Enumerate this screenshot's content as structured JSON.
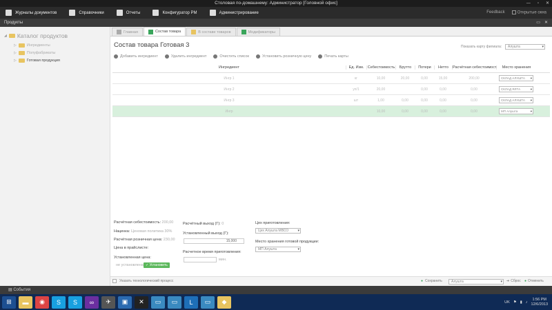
{
  "window": {
    "title": "Столовая по-домашнему: Администратор [Головной офис]",
    "controls": [
      "—",
      "▫",
      "✕"
    ]
  },
  "menu": {
    "items": [
      {
        "label": "Журналы документов",
        "icon": "journal-icon"
      },
      {
        "label": "Справочники",
        "icon": "book-icon"
      },
      {
        "label": "Отчеты",
        "icon": "report-icon"
      },
      {
        "label": "Конфигуратор PM",
        "icon": "config-icon"
      },
      {
        "label": "Администрирование",
        "icon": "admin-icon"
      }
    ],
    "feedback": "Feedback",
    "open_window": "Открытые окна"
  },
  "panel": {
    "title": "Продукты"
  },
  "tree": {
    "root": "Каталог продуктов",
    "items": [
      {
        "label": "Ингредиенты"
      },
      {
        "label": "Полуфабрикаты"
      },
      {
        "label": "Готовая продукция"
      }
    ]
  },
  "tabs": [
    {
      "label": "Главная"
    },
    {
      "label": "Состав товара"
    },
    {
      "label": "В составе товаров"
    },
    {
      "label": "Модификаторы"
    }
  ],
  "page": {
    "title": "Состав товара Готовая 3",
    "show_card_label": "Показать карту филиала:",
    "branch_select": "Алушта"
  },
  "toolbar": {
    "add": "Добавить ингредиент",
    "remove": "Удалить ингредиент",
    "clear": "Очистить список",
    "set_price": "Установить розничную цену",
    "print": "Печать карты"
  },
  "table": {
    "headers": [
      "Ингредиент",
      "Ед. Изм.",
      "Себестоимость",
      "Брутто",
      "Потери",
      "Нетто",
      "Расчётная себестоимость",
      "Место хранения"
    ],
    "rows": [
      [
        "Ингр 1",
        "кг",
        "10,00",
        "20,00",
        "0,00",
        "15,00",
        "200,00",
        "СКЛАД АЛУШТА"
      ],
      [
        "Ингр 2",
        "уп/1",
        "20,00",
        "",
        "0,00",
        "0,00",
        "0,00",
        "СКЛАД ЯЛТА"
      ],
      [
        "Ингр 3",
        "шт",
        "1,00",
        "0,00",
        "0,00",
        "0,00",
        "0,00",
        "СКЛАД АЛУШТА"
      ],
      [
        "Ингр",
        "",
        "10,00",
        "0,00",
        "0,00",
        "0,00",
        "0,00",
        "МП Алушта"
      ]
    ]
  },
  "bottom": {
    "calc_cost_label": "Расчётная себестоимость:",
    "calc_cost_value": "200,00",
    "markup_label": "Наценка:",
    "markup_value": "Ценовая политика 30%",
    "calc_retail_label": "Расчётная розничная цена:",
    "calc_retail_value": "230,00",
    "pricelist_label": "Цена в прайслисте:",
    "set_price_label": "Установленная цена:",
    "not_set": "не установлена",
    "set_button": "Установить",
    "calc_output_label": "Расчётный выход (Г):",
    "calc_output_value": "0",
    "set_output_label": "Установленный выход (Г):",
    "set_output_value": "15,000",
    "prep_time_label": "Расчетное время приготовления:",
    "prep_time_unit": "мин.",
    "workshop_label": "Цех приготовления:",
    "workshop_value": "Цех Алушта МВСО",
    "storage_label": "Место хранения готовой продукции:",
    "storage_value": "МП Алушта",
    "tech_process": "Указать технологический процесс"
  },
  "footer": {
    "save": "Сохранить",
    "branch": "Алушта",
    "reset": "Сброс",
    "cancel": "Отменить"
  },
  "events": {
    "label": "События"
  },
  "taskbar": {
    "lang": "UK",
    "time": "1:56 PM",
    "date": "12/6/2013"
  },
  "colors": {
    "accent": "#3aa55b",
    "titlebar": "#1c1c1c",
    "menubar": "#2b2b2b",
    "highlight_row": "#d8f0dd",
    "taskbar": "#0f2a55"
  }
}
